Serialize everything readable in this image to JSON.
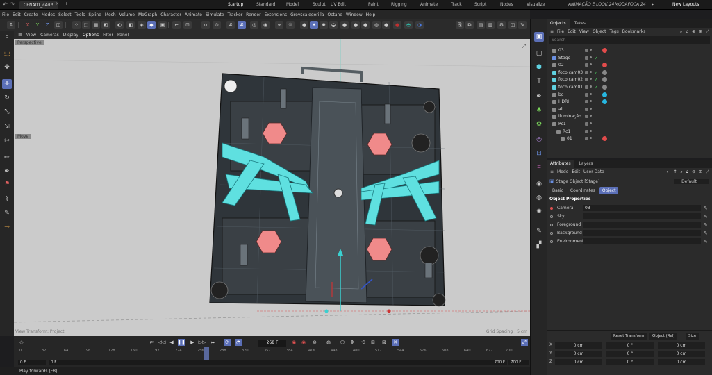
{
  "titlebar": {
    "document_tab": "CENA01_c4d *",
    "layouts": [
      "Startup",
      "Standard",
      "Model",
      "Sculpt",
      "UV Edit",
      "Paint",
      "Rigging",
      "Animate",
      "Track",
      "Script",
      "Nodes",
      "Visualize",
      "ANIMAÇÃO E LOOK 24",
      "MODAFOCA 24"
    ],
    "active_layout": "Startup",
    "new_layouts": "New Layouts"
  },
  "menubar": {
    "items": [
      "File",
      "Edit",
      "Create",
      "Modes",
      "Select",
      "Tools",
      "Spline",
      "Mesh",
      "Volume",
      "MoGraph",
      "Character",
      "Animate",
      "Simulate",
      "Tracker",
      "Render",
      "Extensions",
      "Greyscalegorilla",
      "Octane",
      "Window",
      "Help"
    ]
  },
  "viewport_menu": {
    "items": [
      "View",
      "Cameras",
      "Display",
      "Options",
      "Filter",
      "Panel"
    ]
  },
  "viewport": {
    "camera_label": "Perspective",
    "move_label": "Move",
    "bottom_left": "View Transform: Project",
    "bottom_right": "Grid Spacing : 5 cm"
  },
  "timeline": {
    "current_frame": "268 F",
    "ticks": [
      "0",
      "32",
      "64",
      "96",
      "128",
      "160",
      "192",
      "224",
      "256",
      "288",
      "320",
      "352",
      "384",
      "416",
      "448",
      "480",
      "512",
      "544",
      "576",
      "608",
      "640",
      "672",
      "700"
    ],
    "start_a": "0 F",
    "start_b": "0 F",
    "end_a": "700 F",
    "end_b": "700 F",
    "playhead_frame": 268
  },
  "status": "Play forwards [F8]",
  "objects": {
    "tabs": [
      "Objects",
      "Takes"
    ],
    "menu": [
      "File",
      "Edit",
      "View",
      "Object",
      "Tags",
      "Bookmarks"
    ],
    "search_placeholder": "Search",
    "rows": [
      {
        "name": "03",
        "indent": 0
      },
      {
        "name": "Stage",
        "indent": 0
      },
      {
        "name": "02",
        "indent": 0
      },
      {
        "name": "foco cam03",
        "indent": 0
      },
      {
        "name": "foco cam02",
        "indent": 0
      },
      {
        "name": "foco cam01",
        "indent": 0
      },
      {
        "name": "bg",
        "indent": 0
      },
      {
        "name": "HDRI",
        "indent": 0
      },
      {
        "name": "all",
        "indent": 0
      },
      {
        "name": "iluminação",
        "indent": 0
      },
      {
        "name": "Pc1",
        "indent": 0
      },
      {
        "name": "Rc1",
        "indent": 1
      },
      {
        "name": "01",
        "indent": 2
      }
    ],
    "colors": {
      "green_check": "#4cd964",
      "red_tag": "#e14b4b",
      "cyan_tag": "#27b6e0",
      "selection": "#5b6fb7"
    }
  },
  "attributes": {
    "tabs": [
      "Attributes",
      "Layers"
    ],
    "menu": [
      "Mode",
      "Edit",
      "User Data"
    ],
    "object_title": "Stage Object [Stage]",
    "preset": "Default",
    "subtabs": [
      "Basic",
      "Coordinates",
      "Object"
    ],
    "active_subtab": "Object",
    "section": "Object Properties",
    "properties": [
      {
        "label": "Camera",
        "value": "03"
      },
      {
        "label": "Sky",
        "value": ""
      },
      {
        "label": "Foreground",
        "value": ""
      },
      {
        "label": "Background",
        "value": ""
      },
      {
        "label": "Environment",
        "value": ""
      }
    ]
  },
  "coordinates": {
    "buttons": [
      "Reset Transform",
      "Object (Rel)",
      "Size"
    ],
    "rows": [
      {
        "axis": "X",
        "pos": "0 cm",
        "rot": "0 °",
        "size": "0 cm"
      },
      {
        "axis": "Y",
        "pos": "0 cm",
        "rot": "0 °",
        "size": "0 cm"
      },
      {
        "axis": "Z",
        "pos": "0 cm",
        "rot": "0 °",
        "size": "0 cm"
      }
    ]
  }
}
